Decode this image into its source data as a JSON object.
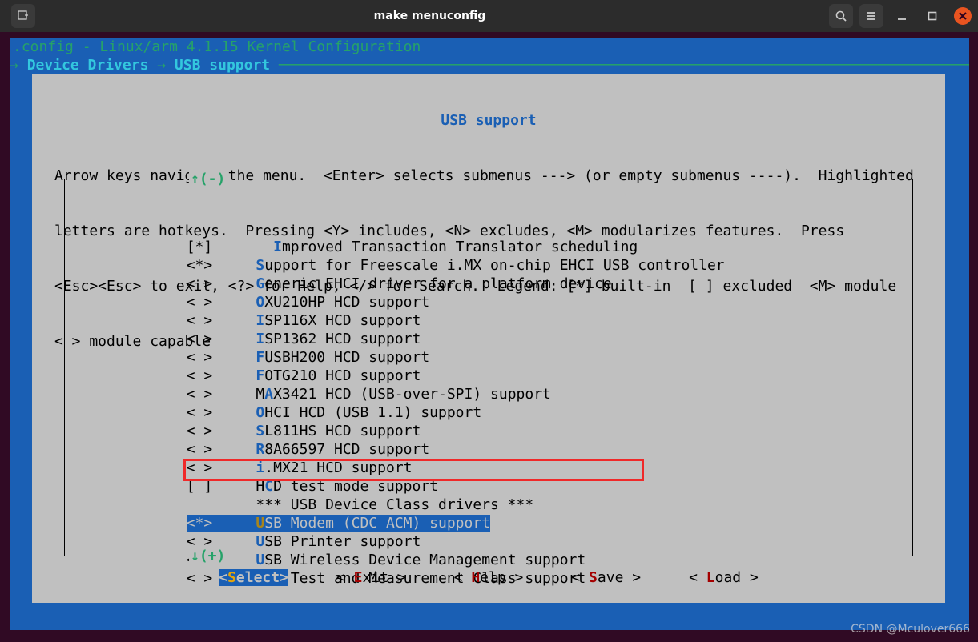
{
  "window": {
    "title": "make menuconfig"
  },
  "config_header": ".config - Linux/arm 4.1.15 Kernel Configuration",
  "breadcrumb": {
    "seg1": "Device Drivers",
    "seg2": "USB support"
  },
  "panel": {
    "title": "USB support",
    "help1": "Arrow keys navigate the menu.  <Enter> selects submenus ---> (or empty submenus ----).  Highlighted",
    "help2": "letters are hotkeys.  Pressing <Y> includes, <N> excludes, <M> modularizes features.  Press",
    "help3": "<Esc><Esc> to exit, <?> for Help, </> for Search.  Legend: [*] built-in  [ ] excluded  <M> module",
    "help4": "< > module capable",
    "scroll_up": "↑(-)",
    "scroll_down": "↓(+)"
  },
  "items": [
    {
      "mark": "[*]",
      "indent": "    ",
      "hk": "I",
      "rest": "mproved Transaction Translator scheduling"
    },
    {
      "mark": "<*>",
      "indent": "  ",
      "hk": "S",
      "rest": "upport for Freescale i.MX on-chip EHCI USB controller"
    },
    {
      "mark": "< >",
      "indent": "  ",
      "hk": "G",
      "rest": "eneric EHCI driver for a platform device"
    },
    {
      "mark": "< >",
      "indent": "  ",
      "hk": "O",
      "rest": "XU210HP HCD support"
    },
    {
      "mark": "< >",
      "indent": "  ",
      "hk": "I",
      "rest": "SP116X HCD support"
    },
    {
      "mark": "< >",
      "indent": "  ",
      "hk": "I",
      "rest": "SP1362 HCD support"
    },
    {
      "mark": "< >",
      "indent": "  ",
      "hk": "F",
      "rest": "USBH200 HCD support"
    },
    {
      "mark": "< >",
      "indent": "  ",
      "hk": "F",
      "rest": "OTG210 HCD support"
    },
    {
      "mark": "< >",
      "indent": "  ",
      "pre": "M",
      "hk": "A",
      "rest": "X3421 HCD (USB-over-SPI) support"
    },
    {
      "mark": "< >",
      "indent": "  ",
      "hk": "O",
      "rest": "HCI HCD (USB 1.1) support"
    },
    {
      "mark": "< >",
      "indent": "  ",
      "hk": "S",
      "rest": "L811HS HCD support"
    },
    {
      "mark": "< >",
      "indent": "  ",
      "hk": "R",
      "rest": "8A66597 HCD support"
    },
    {
      "mark": "< >",
      "indent": "  ",
      "hk": "i",
      "rest": ".MX21 HCD support"
    },
    {
      "mark": "[ ]",
      "indent": "  ",
      "pre": "H",
      "hk": "C",
      "rest": "D test mode support"
    },
    {
      "mark": "   ",
      "indent": "  ",
      "plain": "*** USB Device Class drivers ***"
    },
    {
      "mark": "<*>",
      "indent": "  ",
      "hk": "U",
      "rest": "SB Modem (CDC ACM) support",
      "selected": true
    },
    {
      "mark": "< >",
      "indent": "  ",
      "hk": "U",
      "rest": "SB Printer support"
    },
    {
      "mark": "< >",
      "indent": "  ",
      "hk": "U",
      "rest": "SB Wireless Device Management support"
    },
    {
      "mark": "< >",
      "indent": "  ",
      "hk": "U",
      "rest": "SB Test and Measurement Class support"
    }
  ],
  "buttons": {
    "select": {
      "pre": "<",
      "hk": "S",
      "rest": "elect>",
      "current": true
    },
    "exit": {
      "pre": "< ",
      "hk": "E",
      "rest": "xit >"
    },
    "help": {
      "pre": "< ",
      "hk": "H",
      "rest": "elp >"
    },
    "save": {
      "pre": "< ",
      "hk": "S",
      "rest": "ave >"
    },
    "load": {
      "pre": "< ",
      "hk": "L",
      "rest": "oad >"
    }
  },
  "watermark": "CSDN @Mculover666"
}
